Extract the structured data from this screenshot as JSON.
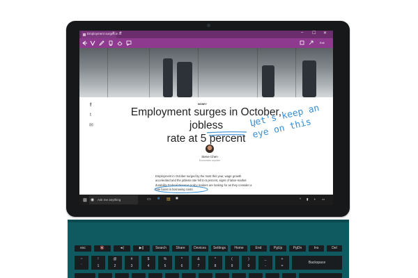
{
  "browser": {
    "tab_title": "Employment surges in O",
    "tab_close": "×",
    "new_tab": "+",
    "window_controls": [
      "–",
      "☐",
      "✕"
    ],
    "toolbar_icons": [
      "back-icon",
      "reading-view-icon",
      "pen-icon",
      "highlighter-icon",
      "eraser-icon",
      "comment-icon",
      "clip-icon",
      "save-icon",
      "share-icon"
    ],
    "exit_label": "Exit"
  },
  "share": {
    "icons": [
      "facebook-icon",
      "twitter-icon",
      "mail-icon"
    ],
    "glyphs": [
      "f",
      "t",
      "✉"
    ]
  },
  "article": {
    "kicker": "MONEY",
    "headline_part1": "Employment surges in October, jobless",
    "headline_part2": "rate at ",
    "headline_highlight": "5 percent",
    "author_name": "Steve Chen",
    "author_role": "Economics reporter",
    "body_line1": "Employment in October surged by the most this year, wage growth",
    "body_line2": "accelerated and the jobless rate fell to 5 percent, signs of labor-market",
    "body_line3": "durability Federal Reserve policy makers are looking for as they consider a",
    "body_line4_pre": "rate ",
    "body_line4_circled": "boost in borrowing costs."
  },
  "ink": {
    "exclamation": "!",
    "line1": "Let's keep an",
    "line2": "eye on this",
    "color": "#3a8fd6"
  },
  "taskbar": {
    "start_glyph": "⊞",
    "mic_glyph": "◉",
    "search_placeholder": "Ask me anything",
    "apps": [
      "task-view-icon",
      "edge-icon",
      "file-explorer-icon",
      "store-icon"
    ],
    "app_glyphs": [
      "▭",
      "e",
      "▤",
      "■"
    ],
    "tray": [
      "^",
      "▮",
      "◑",
      "▭"
    ]
  },
  "keyboard": {
    "row1": [
      "esc",
      "🔇",
      "◄)",
      "▶||",
      "Search",
      "Share",
      "Devices",
      "Settings",
      "Home",
      "End",
      "PgUp",
      "PgDn",
      "Ins",
      "Del"
    ],
    "row2": [
      "~",
      "!",
      "@",
      "#",
      "$",
      "%",
      "^",
      "&",
      "*",
      "(",
      ")",
      "_",
      "+",
      "Backspace"
    ],
    "row2_sub": [
      "`",
      "1",
      "2",
      "3",
      "4",
      "5",
      "6",
      "7",
      "8",
      "9",
      "0",
      "-",
      "="
    ],
    "cover_color": "#0e5a60"
  },
  "colors": {
    "edge_purple": "#8e3b8f",
    "tab_purple": "#6b2d6b",
    "ink_blue": "#3a8fd6"
  }
}
